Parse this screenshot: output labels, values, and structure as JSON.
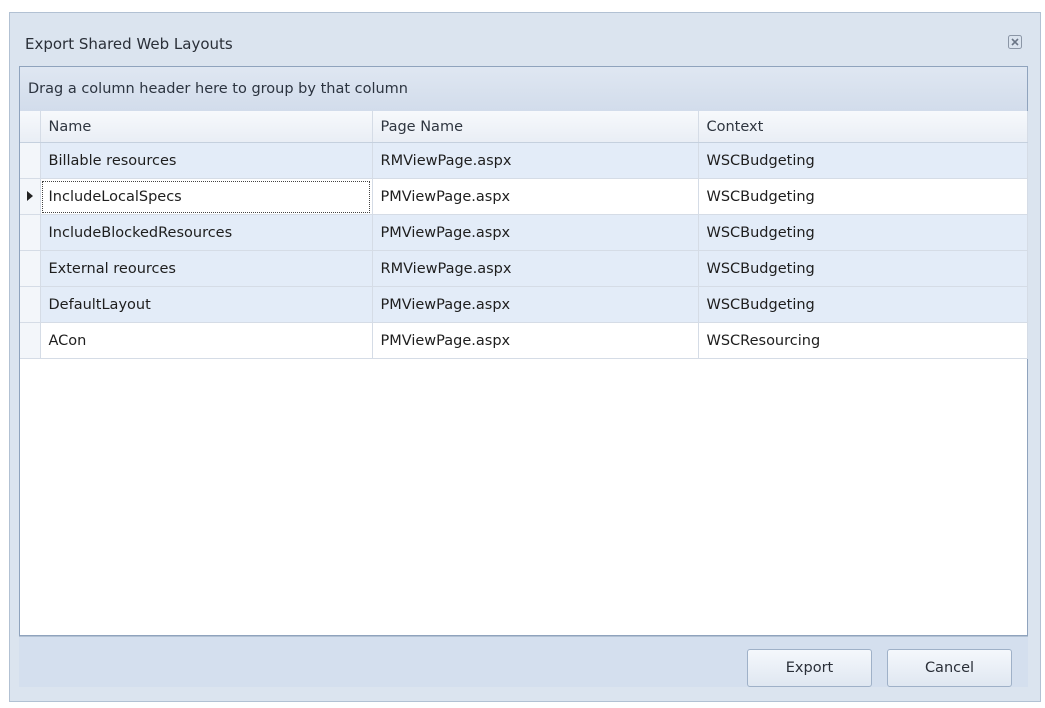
{
  "window": {
    "title": "Export Shared Web Layouts",
    "close_icon": "close-icon"
  },
  "group_panel": {
    "text": "Drag a column header here to group by that column"
  },
  "grid": {
    "columns": [
      "Name",
      "Page Name",
      "Context"
    ],
    "rows": [
      {
        "name": "Billable resources",
        "page": "RMViewPage.aspx",
        "context": "WSCBudgeting"
      },
      {
        "name": "IncludeLocalSpecs",
        "page": "PMViewPage.aspx",
        "context": "WSCBudgeting"
      },
      {
        "name": "IncludeBlockedResources",
        "page": "PMViewPage.aspx",
        "context": "WSCBudgeting"
      },
      {
        "name": "External reources",
        "page": "RMViewPage.aspx",
        "context": "WSCBudgeting"
      },
      {
        "name": "DefaultLayout",
        "page": "PMViewPage.aspx",
        "context": "WSCBudgeting"
      },
      {
        "name": "ACon",
        "page": "PMViewPage.aspx",
        "context": "WSCResourcing"
      }
    ]
  },
  "buttons": {
    "export": "Export",
    "cancel": "Cancel"
  },
  "colors": {
    "window_bg": "#dbe4ef",
    "selected_row": "#e3ecf8",
    "border": "#8fa3bd"
  }
}
